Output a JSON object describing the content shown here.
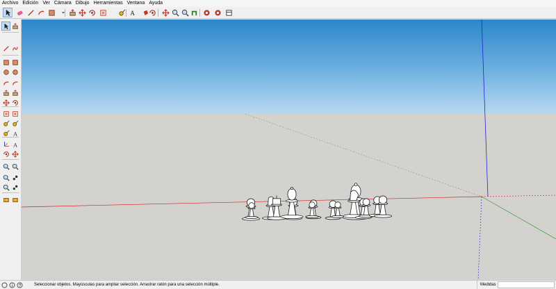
{
  "menu": [
    "Archivo",
    "Edición",
    "Ver",
    "Cámara",
    "Dibujo",
    "Herramientas",
    "Ventana",
    "Ayuda"
  ],
  "toolbar_icons": [
    "select-icon",
    "eraser-icon",
    "line-icon",
    "arc-icon",
    "shapes-icon",
    "dropdown-icon",
    "push-pull-icon",
    "move-icon",
    "rotate-icon",
    "offset-icon",
    "tape-measure-icon",
    "text-icon",
    "paint-bucket-icon",
    "orbit-icon",
    "pan-icon",
    "zoom-icon",
    "zoom-extents-icon",
    "warehouse-icon",
    "share-model-icon",
    "extensions-icon",
    "layout-icon"
  ],
  "left_tools": [
    "select-icon",
    "make-component-icon",
    "line-icon",
    "freehand-icon",
    "rectangle-icon",
    "rotated-rectangle-icon",
    "circle-icon",
    "polygon-icon",
    "arc-icon",
    "pie-icon",
    "push-pull-icon",
    "follow-me-icon",
    "move-icon",
    "rotate-icon",
    "scale-icon",
    "offset-icon",
    "tape-measure-icon",
    "dimension-icon",
    "protractor-icon",
    "text-icon",
    "axes-icon",
    "3d-text-icon",
    "orbit-icon",
    "pan-icon",
    "zoom-icon",
    "zoom-window-icon",
    "zoom-extents-icon",
    "position-camera-icon",
    "look-around-icon",
    "walk-icon",
    "section-plane-icon",
    "section-display-icon"
  ],
  "status": {
    "text": "Seleccionar objetos. Mayúsculas para ampliar selección. Arrastrar ratón para una selección múltiple.",
    "measurements_label": "Medidas",
    "measurements_value": ""
  },
  "colors": {
    "sky_top": "#2c86cb",
    "sky_bottom": "#b7d8ef",
    "ground": "#d4d2ce",
    "red_axis": "#cc2222",
    "green_axis": "#2d9a2d",
    "blue_axis": "#2222cc",
    "selection": "#c8ddf2"
  },
  "scene_objects": [
    "pawn",
    "pawn",
    "knight",
    "king",
    "pawn",
    "bishop",
    "pawn",
    "pawn",
    "pawn",
    "pawn",
    "bishop",
    "knight",
    "pawn",
    "pawn",
    "pawn",
    "pawn"
  ]
}
